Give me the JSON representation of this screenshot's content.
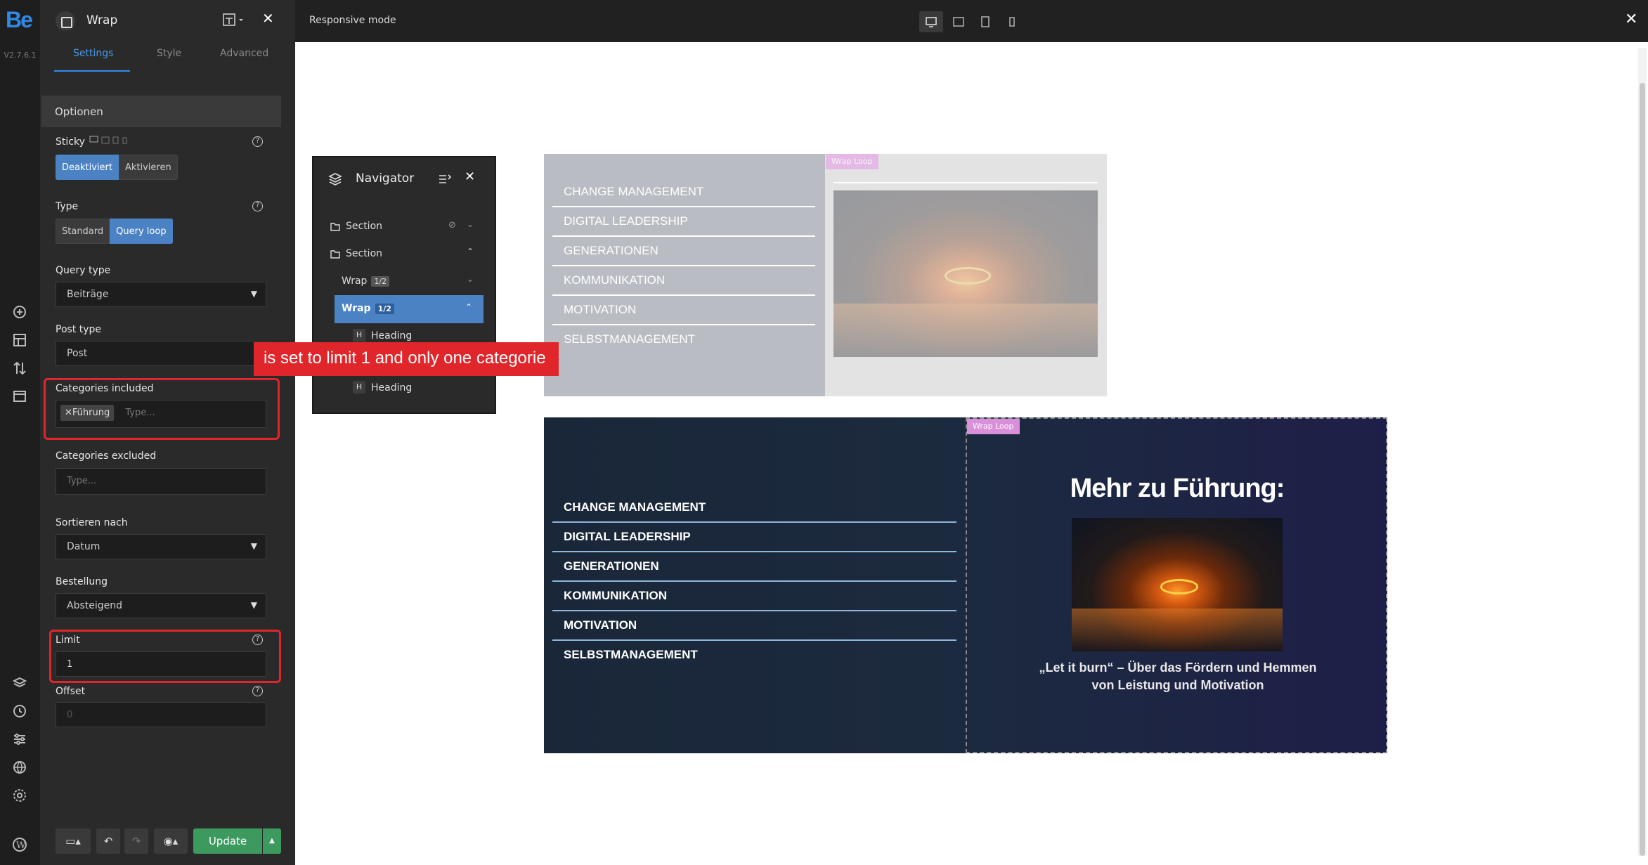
{
  "app": {
    "logo": "Be",
    "version": "V2.7.6.1"
  },
  "panel": {
    "title": "Wrap",
    "tabs": [
      "Settings",
      "Style",
      "Advanced"
    ],
    "section": "Optionen",
    "sticky": {
      "label": "Sticky",
      "options": [
        "Deaktiviert",
        "Aktivieren"
      ],
      "selected": "Deaktiviert"
    },
    "type": {
      "label": "Type",
      "options": [
        "Standard",
        "Query loop"
      ],
      "selected": "Query loop"
    },
    "query_type": {
      "label": "Query type",
      "value": "Beiträge"
    },
    "post_type": {
      "label": "Post type",
      "value": "Post"
    },
    "categories_included": {
      "label": "Categories included",
      "tag": "Führung",
      "placeholder": "Type..."
    },
    "categories_excluded": {
      "label": "Categories excluded",
      "placeholder": "Type..."
    },
    "sort_by": {
      "label": "Sortieren nach",
      "value": "Datum"
    },
    "order": {
      "label": "Bestellung",
      "value": "Absteigend"
    },
    "limit": {
      "label": "Limit",
      "value": "1"
    },
    "offset": {
      "label": "Offset",
      "placeholder": "0"
    },
    "update_label": "Update"
  },
  "topbar": {
    "mode": "Responsive mode"
  },
  "navigator": {
    "title": "Navigator",
    "rows": [
      {
        "label": "Section"
      },
      {
        "label": "Section"
      },
      {
        "label": "Wrap",
        "badge": "1/2"
      },
      {
        "label": "Wrap",
        "badge": "1/2"
      },
      {
        "label": "Heading"
      },
      {
        "label": "Heading"
      }
    ]
  },
  "annotation": "is set to limit 1 and only one categorie",
  "preview": {
    "categories": [
      "CHANGE MANAGEMENT",
      "DIGITAL LEADERSHIP",
      "GENERATIONEN",
      "KOMMUNIKATION",
      "MOTIVATION",
      "SELBSTMANAGEMENT"
    ],
    "wrap_loop_label": "Wrap Loop",
    "heading": "Mehr zu Führung:",
    "post_title": "„Let it burn“ – Über das Fördern und Hemmen von Leistung und Motivation"
  }
}
